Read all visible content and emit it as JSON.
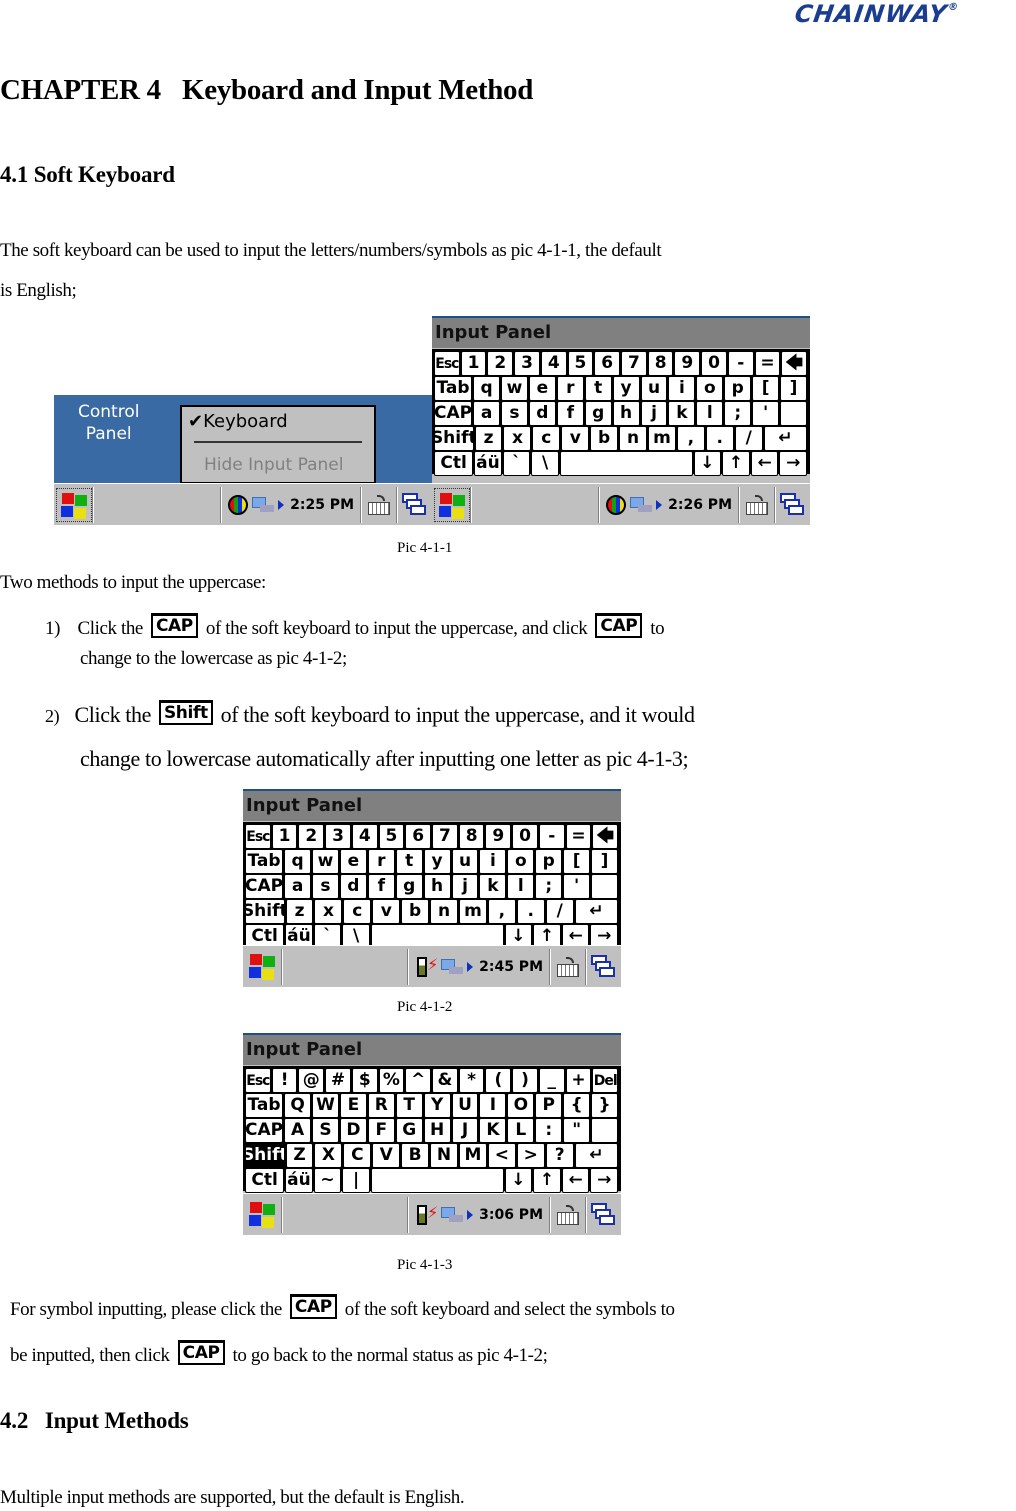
{
  "header": {
    "logo_text": "CHAINWAY",
    "logo_mark": "®"
  },
  "chapter": {
    "number": "CHAPTER 4",
    "title": "Keyboard and Input Method"
  },
  "section_4_1": {
    "heading": "4.1 Soft Keyboard",
    "intro_line1": "The soft keyboard can be used to input the letters/numbers/symbols as pic 4-1-1, the default",
    "intro_line2": "is English;",
    "uppercase_intro": "Two methods to input the uppercase:",
    "method1": {
      "num": "1)",
      "pre": "Click the",
      "key1": "CAP",
      "mid": "of the soft keyboard to input the uppercase, and click",
      "key2": "CAP",
      "post": "to",
      "line2": "change to the lowercase as pic 4-1-2;"
    },
    "method2": {
      "num": "2)",
      "pre": "Click the",
      "key": "Shift",
      "post": "of the soft keyboard to input the uppercase, and it would",
      "line2": "change to lowercase automatically after inputting one letter as pic 4-1-3;"
    },
    "symbol_para": {
      "pre": "For symbol inputting, please click the",
      "key1": "CAP",
      "mid": "of the soft keyboard and select the symbols to",
      "line2_pre": "be inputted, then click",
      "key2": "CAP",
      "line2_post": "to go back to the normal status as pic 4-1-2;"
    }
  },
  "section_4_2": {
    "heading_num": "4.2",
    "heading_title": "Input Methods",
    "body": "Multiple input methods are supported, but the default is English."
  },
  "figures": {
    "pic_4_1_1": {
      "caption": "Pic 4-1-1",
      "left": {
        "desktop_icon_label_line1": "Control",
        "desktop_icon_label_line2": "Panel",
        "menu_item_checked": "Keyboard",
        "menu_check": "✔",
        "menu_item_disabled": "Hide Input Panel",
        "time": "2:25 PM"
      },
      "right": {
        "panel_title": "Input Panel",
        "time": "2:26 PM"
      }
    },
    "pic_4_1_2": {
      "caption": "Pic 4-1-2",
      "panel_title": "Input Panel",
      "time": "2:45 PM"
    },
    "pic_4_1_3": {
      "caption": "Pic 4-1-3",
      "panel_title": "Input Panel",
      "time": "3:06 PM"
    }
  },
  "keyboards": {
    "lower": [
      [
        "Esc",
        "1",
        "2",
        "3",
        "4",
        "5",
        "6",
        "7",
        "8",
        "9",
        "0",
        "-",
        "=",
        "🡄"
      ],
      [
        "Tab",
        "q",
        "w",
        "e",
        "r",
        "t",
        "y",
        "u",
        "i",
        "o",
        "p",
        "[",
        "]"
      ],
      [
        "CAP",
        "a",
        "s",
        "d",
        "f",
        "g",
        "h",
        "j",
        "k",
        "l",
        ";",
        "'",
        ""
      ],
      [
        "Shift",
        "z",
        "x",
        "c",
        "v",
        "b",
        "n",
        "m",
        ",",
        ".",
        "/",
        "↵"
      ],
      [
        "Ctl",
        "áü",
        "`",
        "\\",
        "",
        "↓",
        "↑",
        "←",
        "→"
      ]
    ],
    "upper": [
      [
        "Esc",
        "!",
        "@",
        "#",
        "$",
        "%",
        "^",
        "&",
        "*",
        "(",
        ")",
        "_",
        "+",
        "Del"
      ],
      [
        "Tab",
        "Q",
        "W",
        "E",
        "R",
        "T",
        "Y",
        "U",
        "I",
        "O",
        "P",
        "{",
        "}"
      ],
      [
        "CAP",
        "A",
        "S",
        "D",
        "F",
        "G",
        "H",
        "J",
        "K",
        "L",
        ":",
        "\"",
        ""
      ],
      [
        "Shift",
        "Z",
        "X",
        "C",
        "V",
        "B",
        "N",
        "M",
        "<",
        ">",
        "?",
        "↵"
      ],
      [
        "Ctl",
        "áü",
        "~",
        "|",
        "",
        "↓",
        "↑",
        "←",
        "→"
      ]
    ]
  },
  "colors": {
    "brand": "#1a3d8f",
    "desktop_blue": "#3a6aa4",
    "panel_gray": "#808080",
    "taskbar_gray": "#c0c0c0"
  }
}
